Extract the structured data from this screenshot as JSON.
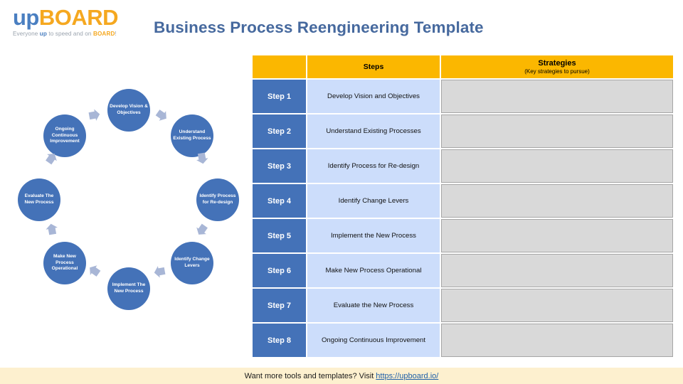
{
  "brand": {
    "logo_up": "up",
    "logo_board": "BOARD",
    "tagline_pre": "Everyone ",
    "tagline_up": "up",
    "tagline_mid": " to speed and on ",
    "tagline_board": "BOARD",
    "tagline_end": "!",
    "color_blue": "#4a7fc1",
    "color_orange": "#f5a820"
  },
  "header": {
    "title": "Business Process Reengineering Template"
  },
  "table": {
    "header": {
      "blank": "",
      "steps": "Steps",
      "strategies": "Strategies",
      "strategies_sub": "(Key strategies to pursue)"
    },
    "rows": [
      {
        "step": "Step 1",
        "description": "Develop Vision and Objectives",
        "strategy": ""
      },
      {
        "step": "Step 2",
        "description": "Understand Existing Processes",
        "strategy": ""
      },
      {
        "step": "Step 3",
        "description": "Identify Process for Re-design",
        "strategy": ""
      },
      {
        "step": "Step 4",
        "description": "Identify Change Levers",
        "strategy": ""
      },
      {
        "step": "Step 5",
        "description": "Implement the New Process",
        "strategy": ""
      },
      {
        "step": "Step 6",
        "description": "Make New Process Operational",
        "strategy": ""
      },
      {
        "step": "Step 7",
        "description": "Evaluate the New Process",
        "strategy": ""
      },
      {
        "step": "Step 8",
        "description": "Ongoing Continuous Improvement",
        "strategy": ""
      }
    ],
    "colors": {
      "header_bg": "#fbb700",
      "step_bg": "#4472b8",
      "desc_bg": "#ccddfb",
      "strategy_bg": "#d9d9d9"
    }
  },
  "cycle": {
    "nodes": [
      {
        "label": "Develop Vision & Objectives"
      },
      {
        "label": "Understand Existing Process"
      },
      {
        "label": "Identify Process for Re-design"
      },
      {
        "label": "Identify Change Levers"
      },
      {
        "label": "Implement The New Process"
      },
      {
        "label": "Make New Process Operational"
      },
      {
        "label": "Evaluate The New Process"
      },
      {
        "label": "Ongoing Continuous Improvement"
      }
    ],
    "node_color": "#4472b8",
    "arrow_color": "#a8b6d6"
  },
  "footer": {
    "text": "Want more tools and templates? Visit",
    "link_label": "https://upboard.io/"
  }
}
